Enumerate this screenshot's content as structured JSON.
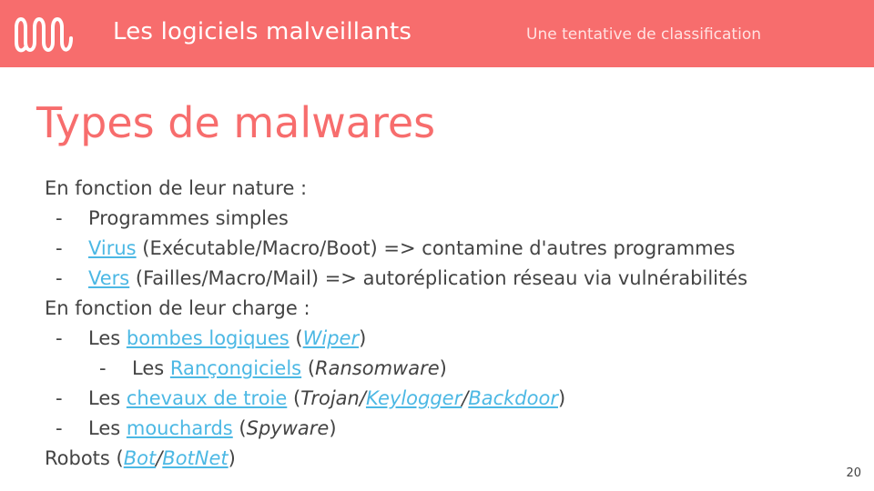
{
  "header": {
    "title": "Les logiciels malveillants",
    "subtitle": "Une tentative de classification",
    "icon": "wave-logo-icon",
    "color": "#f76d6d"
  },
  "slide": {
    "title": "Types de malwares",
    "page_number": "20"
  },
  "content": {
    "nature_heading": "En fonction de leur nature :",
    "programmes_simples": "Programmes simples",
    "virus": {
      "link": "Virus",
      "detail": " (Exécutable/Macro/Boot)  => contamine d'autres programmes"
    },
    "vers": {
      "link": "Vers",
      "detail": " (Failles/Macro/Mail) => autoréplication réseau via vulnérabilités"
    },
    "charge_heading": "En fonction de leur charge :",
    "bombes": {
      "prefix": "Les ",
      "link": "bombes logiques",
      "open": " (",
      "sublink": "Wiper",
      "close": ")"
    },
    "rancon": {
      "prefix": "Les ",
      "link": "Rançongiciels",
      "open": " (",
      "italic": "Ransomware",
      "close": ")"
    },
    "chevaux": {
      "prefix": "Les ",
      "link": "chevaux de troie",
      "open": " (",
      "italic": "Trojan",
      "sep1": "/",
      "sublink1": "Keylogger",
      "sep2": "/",
      "sublink2": "Backdoor",
      "close": ")"
    },
    "mouchards": {
      "prefix": "Les ",
      "link": "mouchards",
      "open": " (",
      "italic": "Spyware",
      "close": ")"
    },
    "robots": {
      "prefix": "Robots (",
      "sublink1": "Bot",
      "sep": "/",
      "sublink2": "BotNet",
      "close": ")"
    },
    "dash": "-",
    "link_color": "#4cb8e4"
  }
}
